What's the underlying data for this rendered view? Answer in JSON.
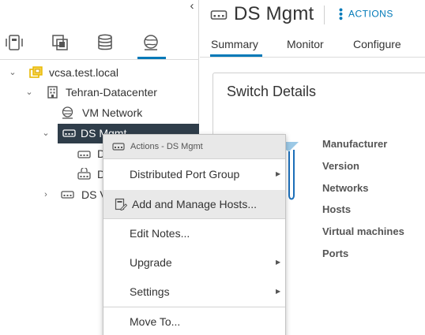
{
  "navigator": {
    "collapse_glyph": "‹",
    "tabs": [
      {
        "name": "hosts-and-clusters",
        "icon": "hosts-clusters-icon"
      },
      {
        "name": "vms-and-templates",
        "icon": "vms-templates-icon"
      },
      {
        "name": "storage",
        "icon": "database-icon"
      },
      {
        "name": "networking",
        "icon": "network-globe-icon",
        "active": true
      }
    ],
    "tree": [
      {
        "label": "vcsa.test.local",
        "icon": "vcenter-icon",
        "expanded": true
      },
      {
        "label": "Tehran-Datacenter",
        "icon": "datacenter-icon",
        "expanded": true
      },
      {
        "label": "VM Network",
        "icon": "network-globe-icon"
      },
      {
        "label": "DS Mgmt",
        "icon": "distributed-switch-icon",
        "expanded": true,
        "selected": true
      },
      {
        "label": "D",
        "icon": "port-group-icon"
      },
      {
        "label": "D",
        "icon": "uplink-port-group-icon"
      },
      {
        "label": "DS V",
        "icon": "distributed-switch-icon",
        "expanded": false
      }
    ]
  },
  "detail": {
    "title": "DS Mgmt",
    "actions_label": "ACTIONS",
    "tabs": [
      "Summary",
      "Monitor",
      "Configure"
    ],
    "active_tab": "Summary",
    "card_title": "Switch Details",
    "properties": [
      "Manufacturer",
      "Version",
      "Networks",
      "Hosts",
      "Virtual machines",
      "Ports"
    ]
  },
  "context_menu": {
    "header": "Actions - DS Mgmt",
    "items": [
      {
        "label": "Distributed Port Group",
        "submenu": true
      },
      {
        "label": "Add and Manage Hosts...",
        "submenu": false,
        "highlighted": true
      },
      {
        "label": "Edit Notes...",
        "submenu": false
      },
      {
        "label": "Upgrade",
        "submenu": true
      },
      {
        "label": "Settings",
        "submenu": true
      },
      {
        "label": "Move To...",
        "submenu": false
      }
    ],
    "submenu_glyph": "▶"
  },
  "colors": {
    "accent": "#0079b8",
    "selected_row": "#2f3d4a",
    "vcenter_icon": "#e8b800",
    "menu_header": "#e8e8e8",
    "menu_highlight": "#e9e9e9"
  }
}
